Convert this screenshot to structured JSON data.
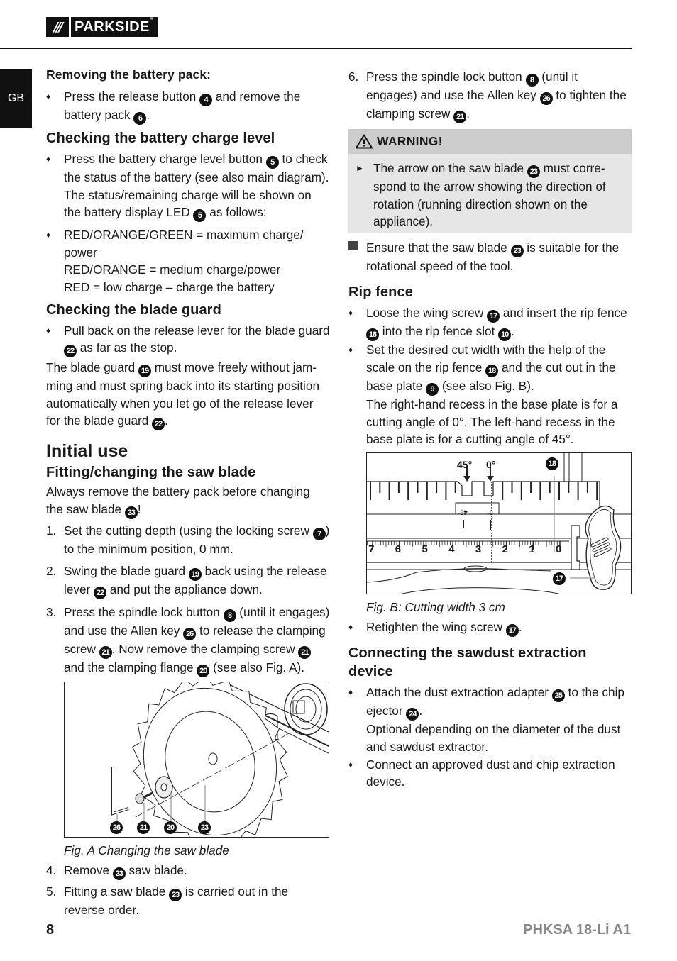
{
  "header": {
    "brand_slashes": "///",
    "brand_name": "PARKSIDE",
    "brand_reg": "®",
    "language_tab": "GB"
  },
  "left": {
    "removing_title": "Removing the battery pack:",
    "removing_bullet_a": "Press the release button ",
    "removing_badge_1": "4",
    "removing_bullet_b": " and remove the battery pack ",
    "removing_badge_2": "6",
    "removing_bullet_c": ".",
    "charge_title": "Checking the battery charge level",
    "charge_b1_a": "Press the battery charge level button ",
    "charge_b1_badge1": "5",
    "charge_b1_b": " to check the status of the battery (see also main diagram). The status/remaining charge will be shown on the battery display LED ",
    "charge_b1_badge2": "5",
    "charge_b1_c": " as follows:",
    "charge_b2_line1": "RED/ORANGE/GREEN = maximum charge/ power",
    "charge_b2_line2": "RED/ORANGE = medium charge/power",
    "charge_b2_line3": "RED = low charge – charge the battery",
    "guard_title": "Checking the blade guard",
    "guard_b1_a": "Pull back on the release lever for the blade guard ",
    "guard_b1_badge": "22",
    "guard_b1_b": " as far as the stop.",
    "guard_p_a": "The blade guard ",
    "guard_p_badge1": "19",
    "guard_p_b": " must move freely without jam-ming and must spring back into its starting position automatically when you let go of the release lever for the blade guard ",
    "guard_p_badge2": "22",
    "guard_p_c": ".",
    "initial_title": "Initial use",
    "fitting_title": "Fitting/changing the saw blade",
    "fitting_p_a": "Always remove the battery pack before changing the saw blade ",
    "fitting_p_badge": "23",
    "fitting_p_b": "!",
    "steps": [
      {
        "n": "1.",
        "a": "Set the cutting depth (using the locking screw ",
        "badge": "7",
        "b": ") to the minimum position, 0 mm."
      },
      {
        "n": "2.",
        "a": "Swing the blade guard ",
        "badge": "19",
        "b": " back using the release lever ",
        "badge2": "22",
        "c": " and put the appliance down."
      },
      {
        "n": "3.",
        "a": "Press the spindle lock button ",
        "badge": "8",
        "b": " (until it engages) and use the Allen key ",
        "badge2": "26",
        "c": " to release the clamping screw ",
        "badge3": "21",
        "d": ". Now remove the clamping screw ",
        "badge4": "21",
        "e": " and the clamping flange ",
        "badge5": "20",
        "f": " (see also Fig. A)."
      },
      {
        "n": "4.",
        "a": "Remove ",
        "badge": "23",
        "b": " saw blade."
      },
      {
        "n": "5.",
        "a": "Fitting a saw blade ",
        "badge": "23",
        "b": " is carried out in the reverse order."
      }
    ],
    "fig_a_labels": [
      "26",
      "21",
      "20",
      "23"
    ],
    "fig_a_caption": "Fig. A Changing the saw blade"
  },
  "right": {
    "step6": {
      "n": "6.",
      "a": "Press the spindle lock button ",
      "badge": "8",
      "b": " (until it engages) and use the Allen key ",
      "badge2": "26",
      "c": " to tighten the clamping screw ",
      "badge3": "21",
      "d": "."
    },
    "warning_title": "WARNING!",
    "warning_a": "The arrow on the saw blade ",
    "warning_badge": "23",
    "warning_b": " must corre-spond to the arrow showing the direction of rotation (running direction shown on the appliance).",
    "ensure_a": "Ensure that the saw blade ",
    "ensure_badge": "23",
    "ensure_b": " is suitable for the rotational speed of the tool.",
    "rip_title": "Rip fence",
    "rip_b1_a": "Loose the wing screw ",
    "rip_b1_badge1": "17",
    "rip_b1_b": " and insert the rip fence ",
    "rip_b1_badge2": "18",
    "rip_b1_c": " into the rip fence slot ",
    "rip_b1_badge3": "10",
    "rip_b1_d": ".",
    "rip_b2_a": "Set the desired cut width with the help of the scale on the rip fence ",
    "rip_b2_badge1": "18",
    "rip_b2_b": " and the cut out in the base plate ",
    "rip_b2_badge2": "9",
    "rip_b2_c": " (see also Fig. B).",
    "rip_b2_d": "The right-hand recess in the base plate is for a cutting angle of 0°. The left-hand recess in the base plate is for a cutting angle of 45°.",
    "fig_b": {
      "angle_45": "45°",
      "angle_0": "0°",
      "inv_45": "45°",
      "inv_0": "0°",
      "scale": [
        "7",
        "6",
        "5",
        "4",
        "3",
        "2",
        "1",
        "0"
      ],
      "label_fence": "18",
      "label_screw": "17"
    },
    "fig_b_caption": "Fig. B: Cutting width 3 cm",
    "retighten_a": "Retighten the wing screw ",
    "retighten_badge": "17",
    "retighten_b": ".",
    "dust_title": "Connecting the sawdust extraction device",
    "dust_b1_a": "Attach the dust extraction adapter ",
    "dust_b1_badge1": "25",
    "dust_b1_b": " to the chip ejector ",
    "dust_b1_badge2": "24",
    "dust_b1_c": ".",
    "dust_b1_d": "Optional depending on the diameter of the dust and sawdust extractor.",
    "dust_b2": "Connect an approved dust and chip extraction device."
  },
  "footer": {
    "page_number": "8",
    "model": "PHKSA 18-Li A1"
  },
  "glyphs": {
    "diamond": "♦",
    "triangle_right": "►"
  }
}
